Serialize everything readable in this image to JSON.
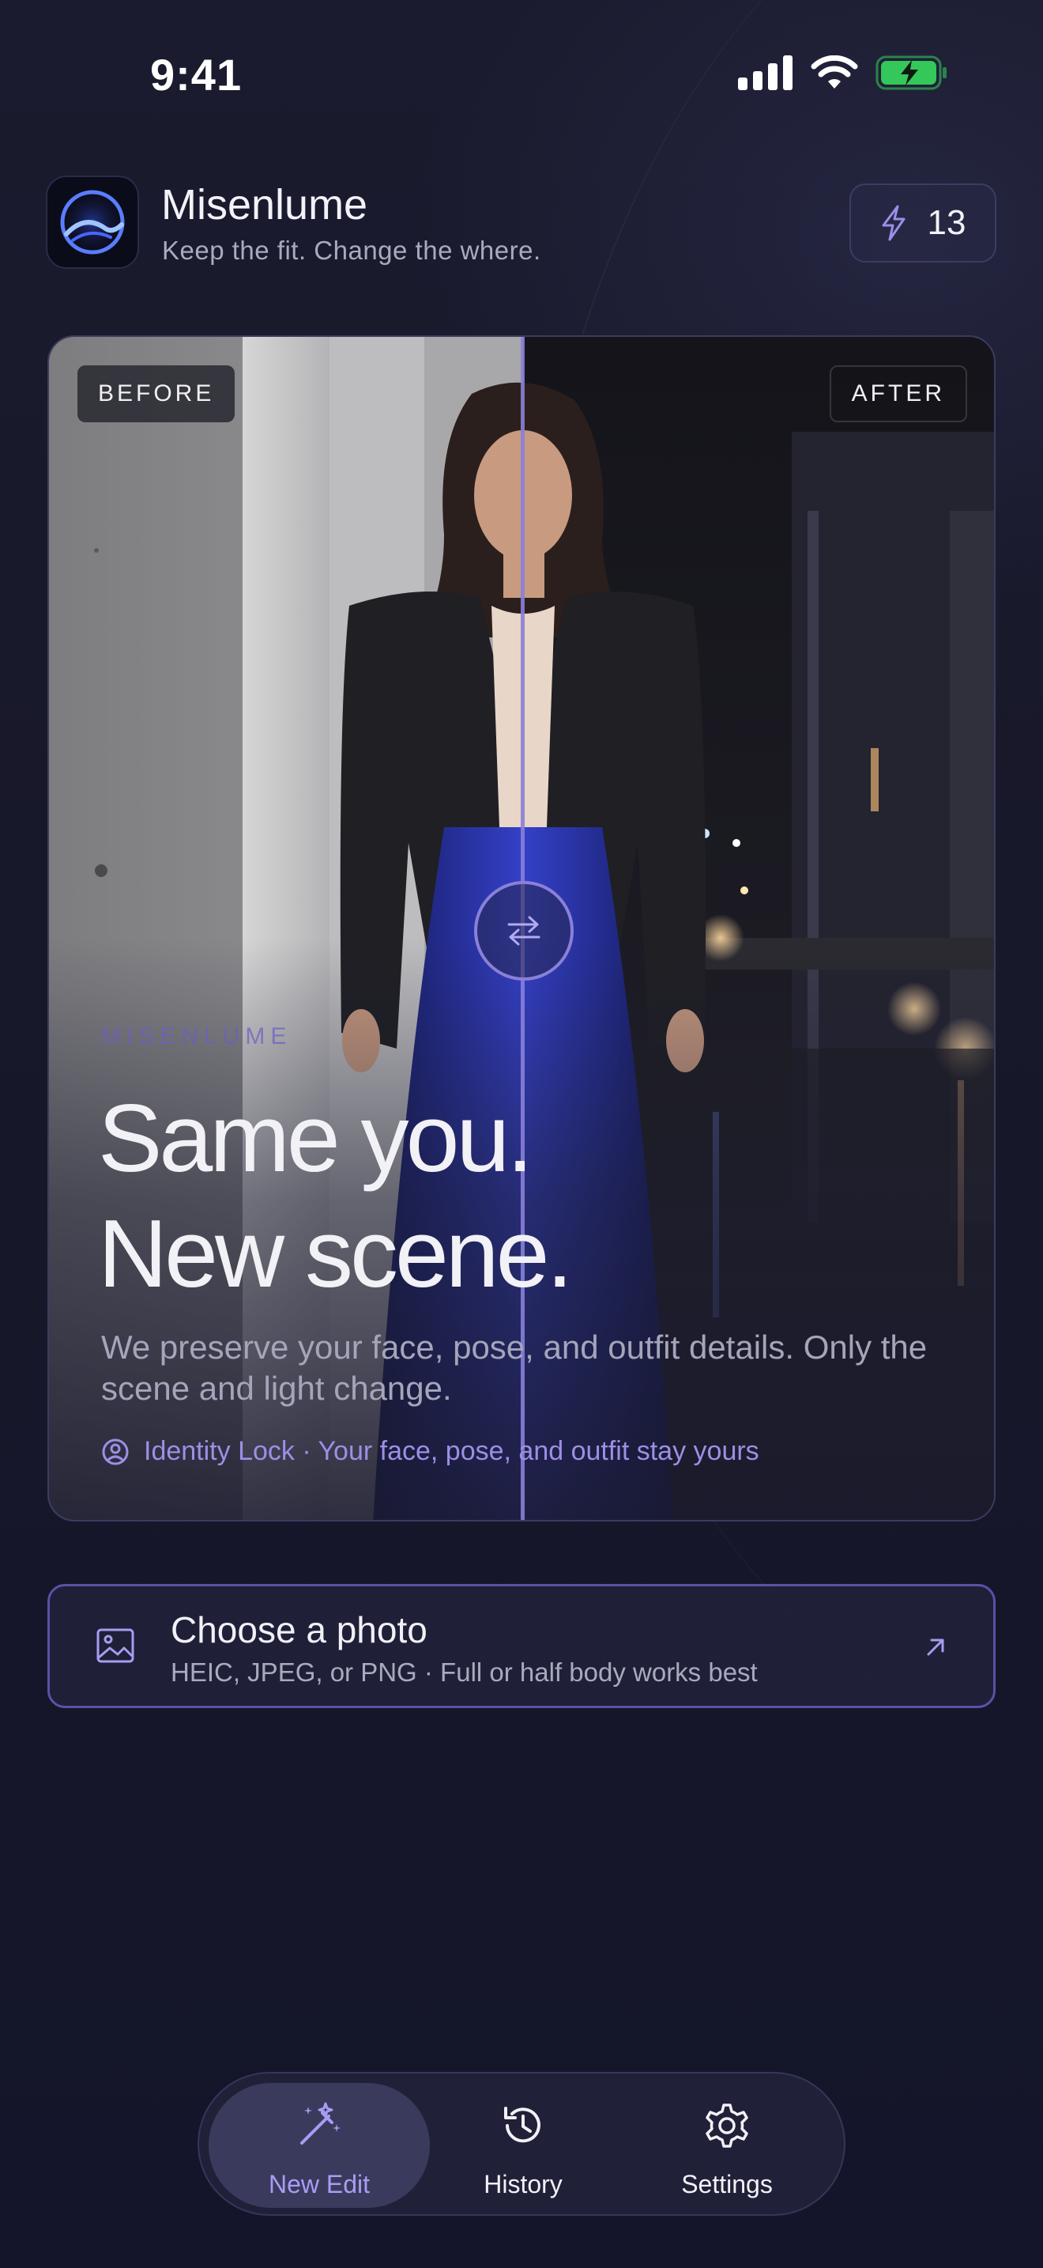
{
  "status_bar": {
    "time": "9:41"
  },
  "header": {
    "app_name": "Misenlume",
    "tagline": "Keep the fit. Change the where.",
    "credits": "13"
  },
  "hero": {
    "before_label": "BEFORE",
    "after_label": "AFTER",
    "eyebrow": "MISENLUME",
    "headline_line1": "Same you.",
    "headline_line2": "New scene.",
    "body": "We preserve your face, pose, and outfit details. Only the scene and light change.",
    "identity_lock": "Identity Lock · Your face, pose, and outfit stay yours"
  },
  "choose_photo": {
    "title": "Choose a photo",
    "subtitle": "HEIC, JPEG, or PNG · Full or half body works best"
  },
  "tabbar": {
    "tabs": [
      {
        "label": "New Edit",
        "icon": "magic-wand-icon",
        "active": true
      },
      {
        "label": "History",
        "icon": "history-icon",
        "active": false
      },
      {
        "label": "Settings",
        "icon": "gear-icon",
        "active": false
      }
    ]
  },
  "colors": {
    "accent": "#8A80D8",
    "background": "#171829",
    "battery": "#34C759"
  }
}
